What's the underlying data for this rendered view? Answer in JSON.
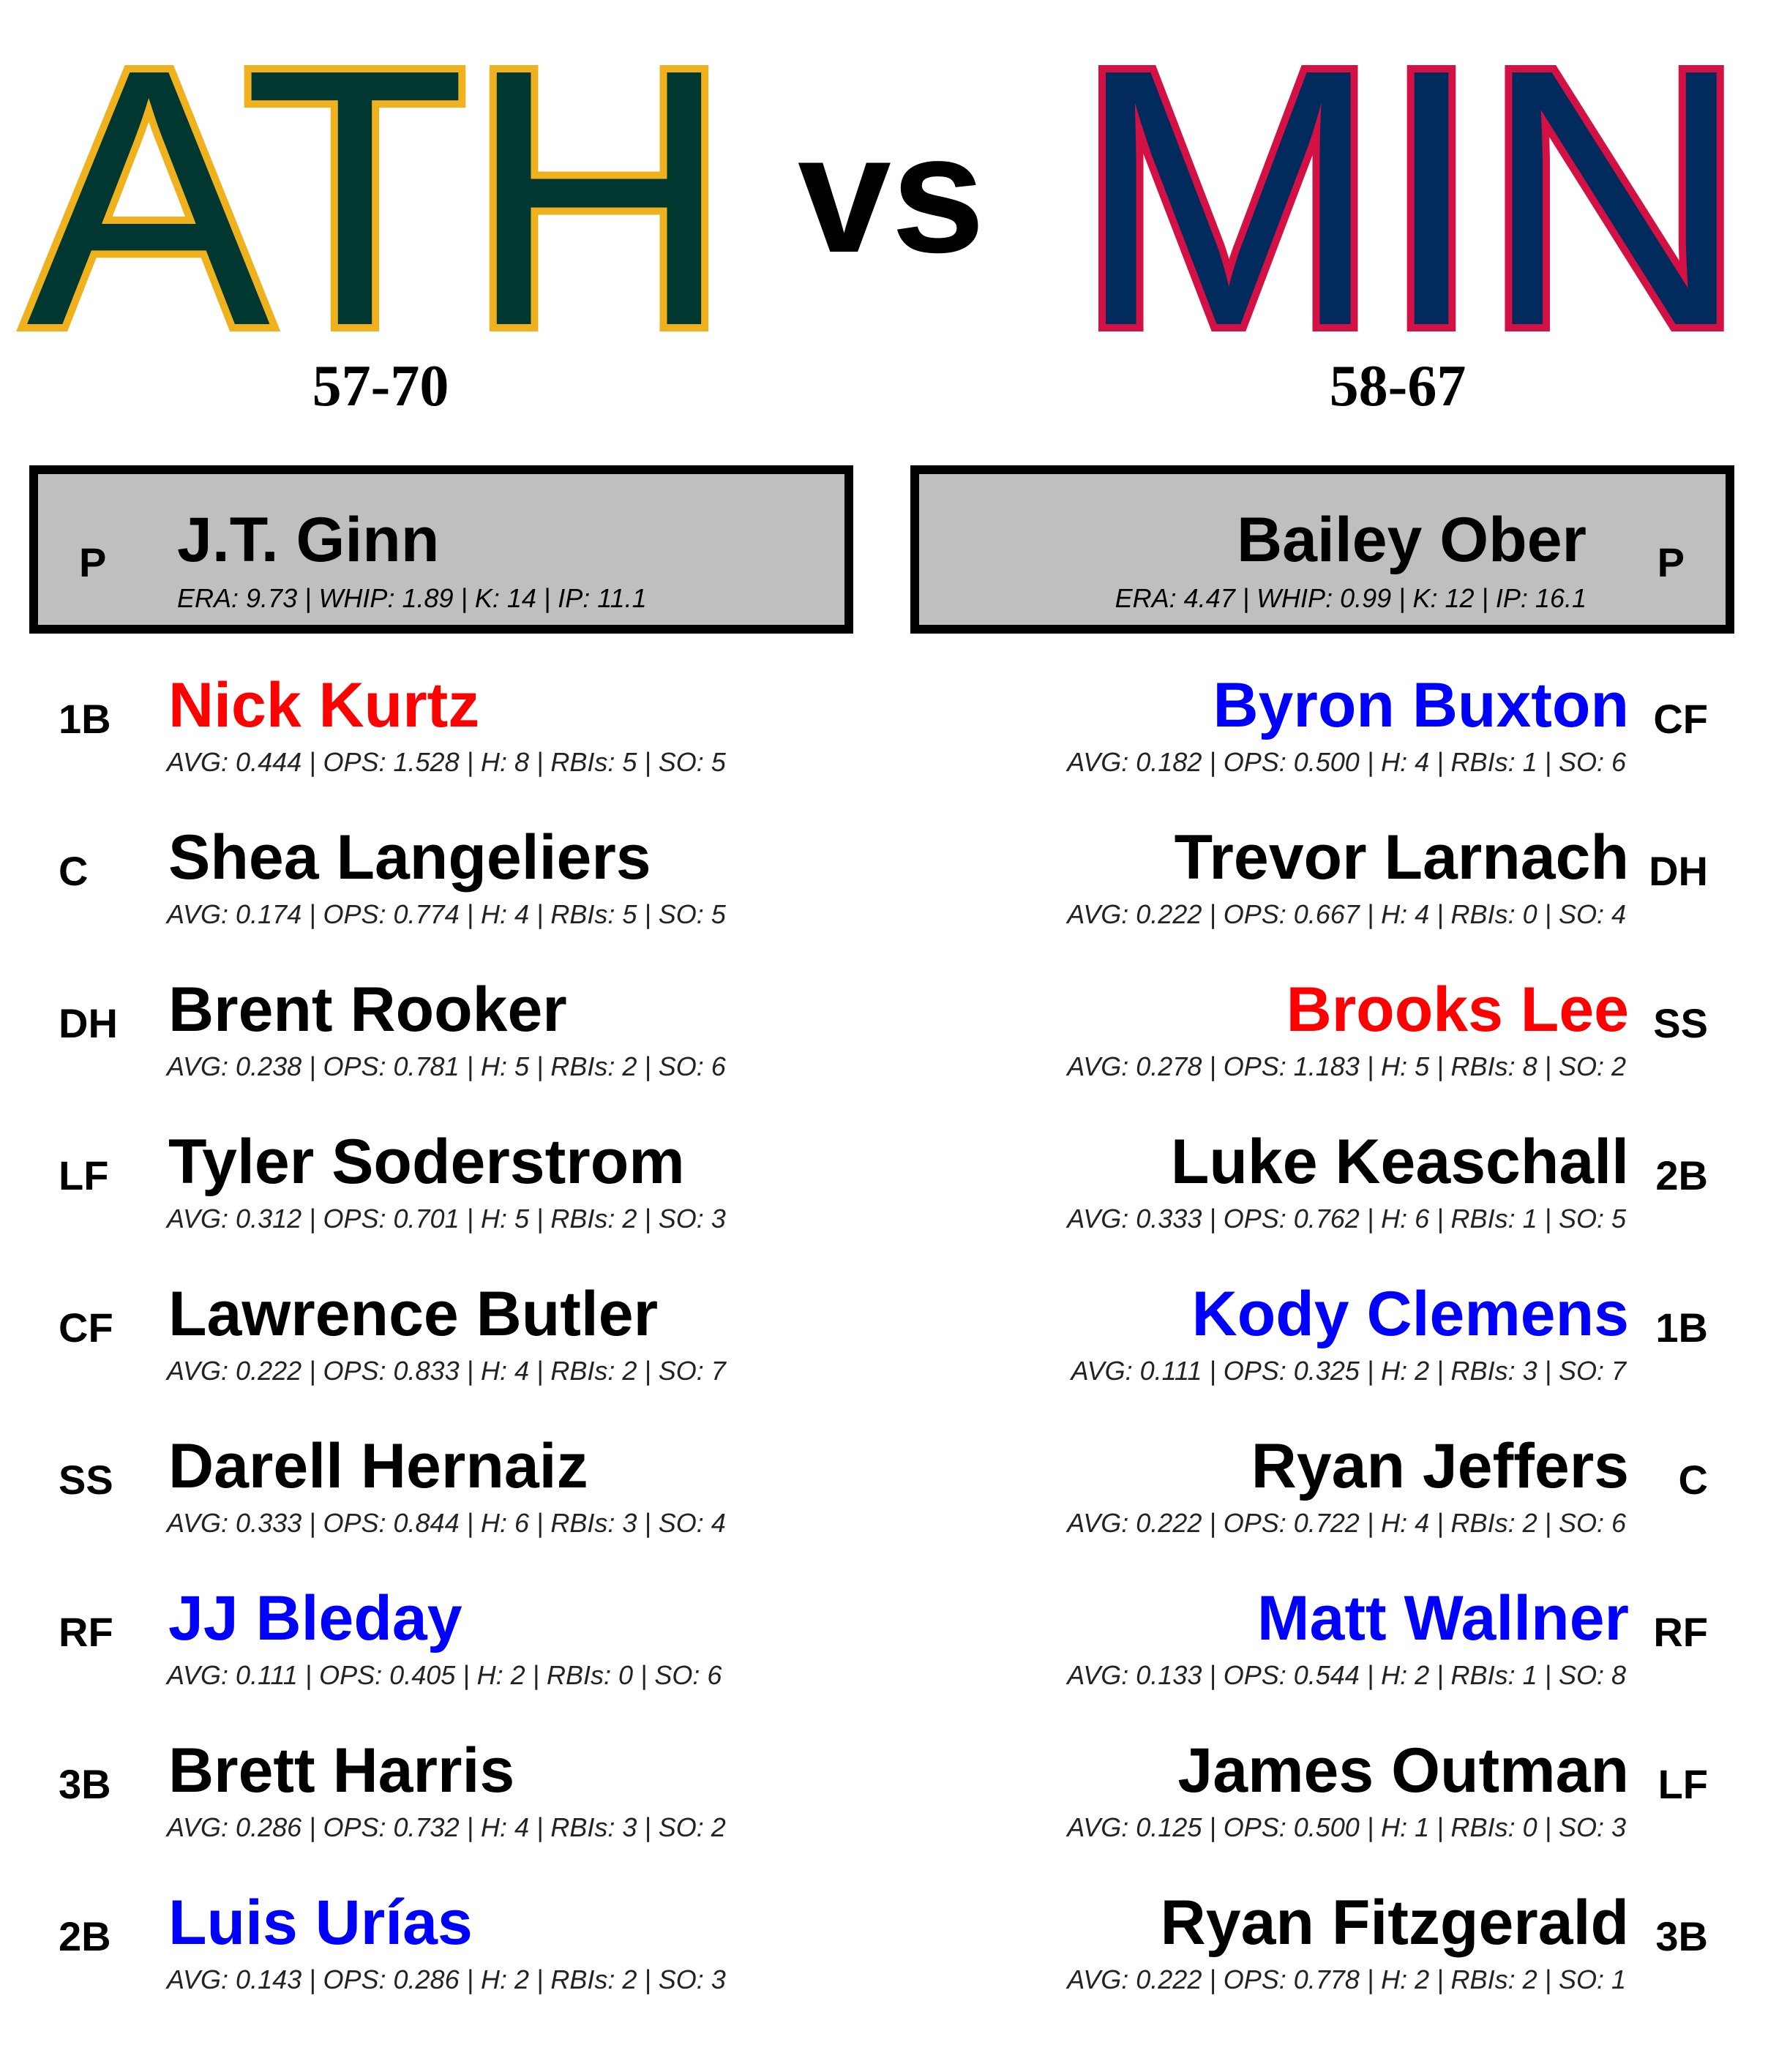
{
  "home": {
    "abbr": "ATH",
    "fill_color": "#003831",
    "stroke_color": "#EFB21E",
    "record": "57-70",
    "pitcher": {
      "position": "P",
      "name": "J.T. Ginn",
      "stats": "ERA: 9.73 | WHIP: 1.89 | K: 14 | IP: 11.1"
    },
    "lineup": [
      {
        "position": "1B",
        "name": "Nick Kurtz",
        "color": "#ff0000",
        "stats": "AVG: 0.444 | OPS: 1.528 | H: 8 | RBIs: 5 | SO: 5"
      },
      {
        "position": "C",
        "name": "Shea Langeliers",
        "color": "#000000",
        "stats": "AVG: 0.174 | OPS: 0.774 | H: 4 | RBIs: 5 | SO: 5"
      },
      {
        "position": "DH",
        "name": "Brent Rooker",
        "color": "#000000",
        "stats": "AVG: 0.238 | OPS: 0.781 | H: 5 | RBIs: 2 | SO: 6"
      },
      {
        "position": "LF",
        "name": "Tyler Soderstrom",
        "color": "#000000",
        "stats": "AVG: 0.312 | OPS: 0.701 | H: 5 | RBIs: 2 | SO: 3"
      },
      {
        "position": "CF",
        "name": "Lawrence Butler",
        "color": "#000000",
        "stats": "AVG: 0.222 | OPS: 0.833 | H: 4 | RBIs: 2 | SO: 7"
      },
      {
        "position": "SS",
        "name": "Darell Hernaiz",
        "color": "#000000",
        "stats": "AVG: 0.333 | OPS: 0.844 | H: 6 | RBIs: 3 | SO: 4"
      },
      {
        "position": "RF",
        "name": "JJ Bleday",
        "color": "#0000ff",
        "stats": "AVG: 0.111 | OPS: 0.405 | H: 2 | RBIs: 0 | SO: 6"
      },
      {
        "position": "3B",
        "name": "Brett Harris",
        "color": "#000000",
        "stats": "AVG: 0.286 | OPS: 0.732 | H: 4 | RBIs: 3 | SO: 2"
      },
      {
        "position": "2B",
        "name": "Luis Urías",
        "color": "#0000ff",
        "stats": "AVG: 0.143 | OPS: 0.286 | H: 2 | RBIs: 2 | SO: 3"
      }
    ]
  },
  "vs_label": "vs",
  "away": {
    "abbr": "MIN",
    "fill_color": "#002B5C",
    "stroke_color": "#D31145",
    "record": "58-67",
    "pitcher": {
      "position": "P",
      "name": "Bailey Ober",
      "stats": "ERA: 4.47 | WHIP: 0.99 | K: 12 | IP: 16.1"
    },
    "lineup": [
      {
        "position": "CF",
        "name": "Byron Buxton",
        "color": "#0000ff",
        "stats": "AVG: 0.182 | OPS: 0.500 | H: 4 | RBIs: 1 | SO: 6"
      },
      {
        "position": "DH",
        "name": "Trevor Larnach",
        "color": "#000000",
        "stats": "AVG: 0.222 | OPS: 0.667 | H: 4 | RBIs: 0 | SO: 4"
      },
      {
        "position": "SS",
        "name": "Brooks Lee",
        "color": "#ff0000",
        "stats": "AVG: 0.278 | OPS: 1.183 | H: 5 | RBIs: 8 | SO: 2"
      },
      {
        "position": "2B",
        "name": "Luke Keaschall",
        "color": "#000000",
        "stats": "AVG: 0.333 | OPS: 0.762 | H: 6 | RBIs: 1 | SO: 5"
      },
      {
        "position": "1B",
        "name": "Kody Clemens",
        "color": "#0000ff",
        "stats": "AVG: 0.111 | OPS: 0.325 | H: 2 | RBIs: 3 | SO: 7"
      },
      {
        "position": "C",
        "name": "Ryan Jeffers",
        "color": "#000000",
        "stats": "AVG: 0.222 | OPS: 0.722 | H: 4 | RBIs: 2 | SO: 6"
      },
      {
        "position": "RF",
        "name": "Matt Wallner",
        "color": "#0000ff",
        "stats": "AVG: 0.133 | OPS: 0.544 | H: 2 | RBIs: 1 | SO: 8"
      },
      {
        "position": "LF",
        "name": "James Outman",
        "color": "#000000",
        "stats": "AVG: 0.125 | OPS: 0.500 | H: 1 | RBIs: 0 | SO: 3"
      },
      {
        "position": "3B",
        "name": "Ryan Fitzgerald",
        "color": "#000000",
        "stats": "AVG: 0.222 | OPS: 0.778 | H: 2 | RBIs: 2 | SO: 1"
      }
    ]
  }
}
